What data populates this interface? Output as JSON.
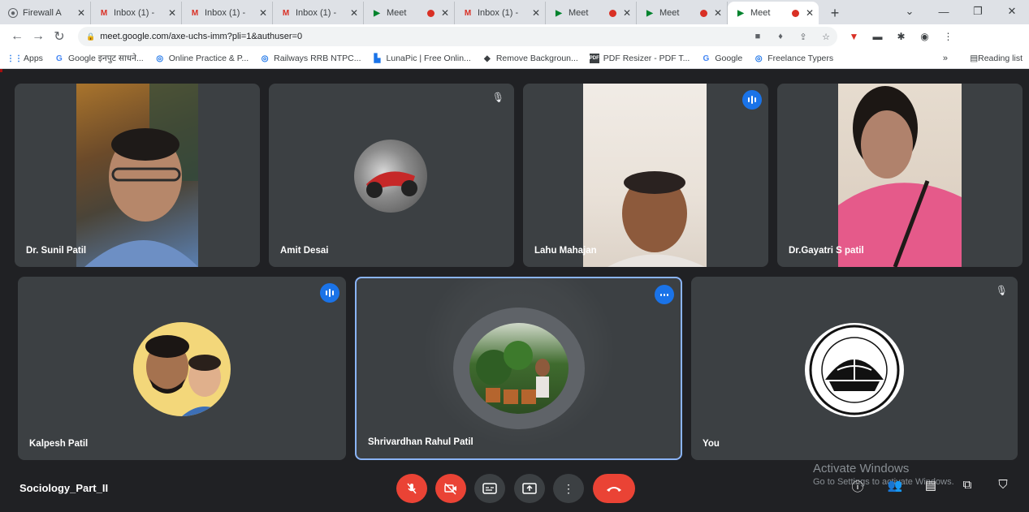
{
  "browser": {
    "tabs": [
      {
        "icon": "firewall-icon",
        "label": "Firewall A",
        "recording": false,
        "active": false
      },
      {
        "icon": "gmail-icon",
        "label": "Inbox (1) -",
        "recording": false,
        "active": false
      },
      {
        "icon": "gmail-icon",
        "label": "Inbox (1) -",
        "recording": false,
        "active": false
      },
      {
        "icon": "gmail-icon",
        "label": "Inbox (1) -",
        "recording": false,
        "active": false
      },
      {
        "icon": "meet-icon",
        "label": "Meet",
        "recording": true,
        "active": false
      },
      {
        "icon": "gmail-icon",
        "label": "Inbox (1) -",
        "recording": false,
        "active": false
      },
      {
        "icon": "meet-icon",
        "label": "Meet",
        "recording": true,
        "active": false
      },
      {
        "icon": "meet-icon",
        "label": "Meet",
        "recording": true,
        "active": false
      },
      {
        "icon": "meet-icon",
        "label": "Meet",
        "recording": true,
        "active": true
      }
    ],
    "url": "meet.google.com/axe-uchs-imm?pli=1&authuser=0",
    "bookmarks": [
      {
        "icon": "apps-grid-icon",
        "label": "Apps"
      },
      {
        "icon": "google-g-icon",
        "label": "Google इनपुट साधने..."
      },
      {
        "icon": "globe-icon",
        "label": "Online Practice & P..."
      },
      {
        "icon": "globe-icon",
        "label": "Railways RRB NTPC..."
      },
      {
        "icon": "lunapic-icon",
        "label": "LunaPic | Free Onlin..."
      },
      {
        "icon": "bird-icon",
        "label": "Remove Backgroun..."
      },
      {
        "icon": "pdf-icon",
        "label": "PDF Resizer - PDF T..."
      },
      {
        "icon": "google-g-icon",
        "label": "Google"
      },
      {
        "icon": "globe-icon",
        "label": "Freelance Typers"
      }
    ],
    "bookmarks_more": "»",
    "reading_list": "Reading list"
  },
  "meet": {
    "participants": [
      {
        "name": "Dr. Sunil Patil"
      },
      {
        "name": "Amit Desai"
      },
      {
        "name": "Lahu Mahajan"
      },
      {
        "name": "Dr.Gayatri S patil"
      },
      {
        "name": "Kalpesh Patil"
      },
      {
        "name": "Shrivardhan Rahul Patil"
      },
      {
        "name": "You"
      }
    ],
    "meeting_name": "Sociology_Part_II"
  },
  "windows_watermark": {
    "line1": "Activate Windows",
    "line2": "Go to Settings to activate Windows."
  },
  "colors": {
    "meet_background": "#202124",
    "tile": "#3c4043",
    "danger": "#ea4335",
    "speaking": "#1a73e8",
    "active_border": "#8ab4f8"
  }
}
